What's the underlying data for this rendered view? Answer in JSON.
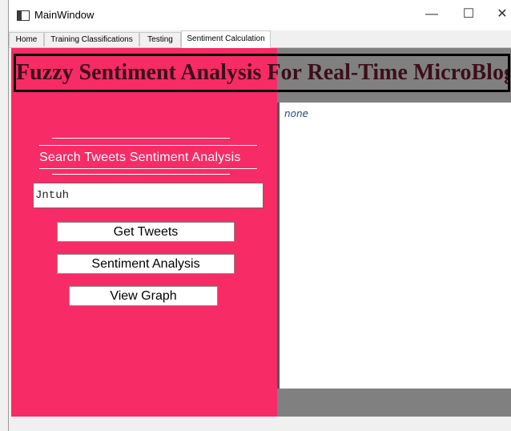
{
  "window": {
    "title": "MainWindow",
    "minimize_glyph": "—",
    "maximize_glyph": "☐",
    "close_glyph": "✕"
  },
  "tabs": [
    {
      "label": "Home"
    },
    {
      "label": "Training Classifications"
    },
    {
      "label": "Testing"
    },
    {
      "label": "Sentiment Calculation",
      "active": true
    }
  ],
  "banner": {
    "title": "Fuzzy Sentiment Analysis For Real-Time MicroBlogs"
  },
  "panel": {
    "section_title": "Search Tweets Sentiment Analysis",
    "search_value": "Jntuh",
    "buttons": {
      "get_tweets": "Get Tweets",
      "sentiment_analysis": "Sentiment Analysis",
      "view_graph": "View Graph"
    }
  },
  "output": {
    "text": "none"
  },
  "colors": {
    "panel_bg": "#f72b65",
    "gray_bg": "#808080",
    "output_text": "#24487a"
  }
}
